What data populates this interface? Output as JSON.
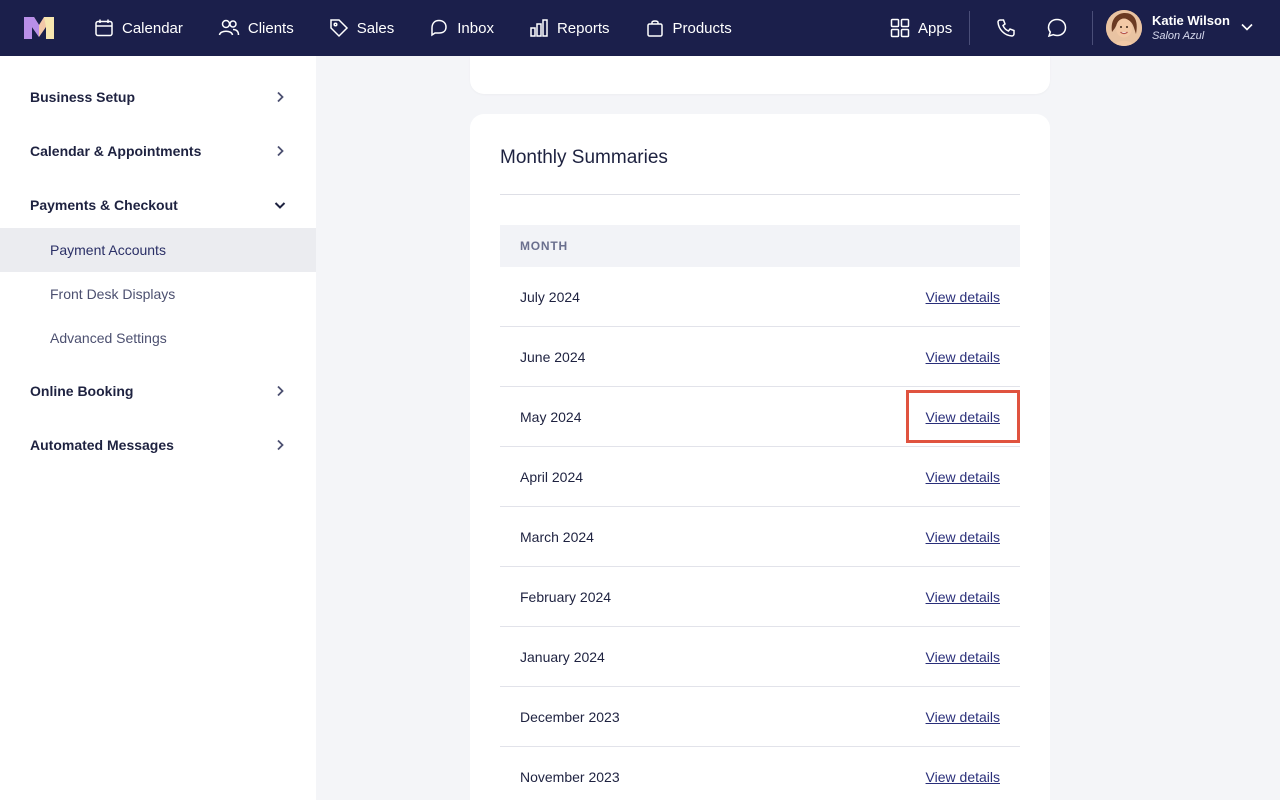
{
  "header": {
    "nav": [
      {
        "label": "Calendar",
        "icon": "calendar-icon"
      },
      {
        "label": "Clients",
        "icon": "clients-icon"
      },
      {
        "label": "Sales",
        "icon": "tag-icon"
      },
      {
        "label": "Inbox",
        "icon": "inbox-icon"
      },
      {
        "label": "Reports",
        "icon": "reports-icon"
      },
      {
        "label": "Products",
        "icon": "bag-icon"
      }
    ],
    "apps_label": "Apps",
    "user": {
      "name": "Katie Wilson",
      "business": "Salon Azul"
    }
  },
  "sidebar": {
    "sections": [
      {
        "label": "Business Setup",
        "expanded": false
      },
      {
        "label": "Calendar & Appointments",
        "expanded": false
      },
      {
        "label": "Payments & Checkout",
        "expanded": true
      },
      {
        "label": "Online Booking",
        "expanded": false
      },
      {
        "label": "Automated Messages",
        "expanded": false
      }
    ],
    "sub_items": [
      {
        "label": "Payment Accounts",
        "active": true
      },
      {
        "label": "Front Desk Displays",
        "active": false
      },
      {
        "label": "Advanced Settings",
        "active": false
      }
    ]
  },
  "main": {
    "title": "Monthly Summaries",
    "column_header": "MONTH",
    "rows": [
      {
        "month": "July 2024",
        "link": "View details"
      },
      {
        "month": "June 2024",
        "link": "View details"
      },
      {
        "month": "May 2024",
        "link": "View details"
      },
      {
        "month": "April 2024",
        "link": "View details"
      },
      {
        "month": "March 2024",
        "link": "View details"
      },
      {
        "month": "February 2024",
        "link": "View details"
      },
      {
        "month": "January 2024",
        "link": "View details"
      },
      {
        "month": "December 2023",
        "link": "View details"
      },
      {
        "month": "November 2023",
        "link": "View details"
      }
    ]
  },
  "colors": {
    "topbar": "#1b1f4b",
    "highlight": "#e0533f",
    "link": "#2a2f7a"
  }
}
